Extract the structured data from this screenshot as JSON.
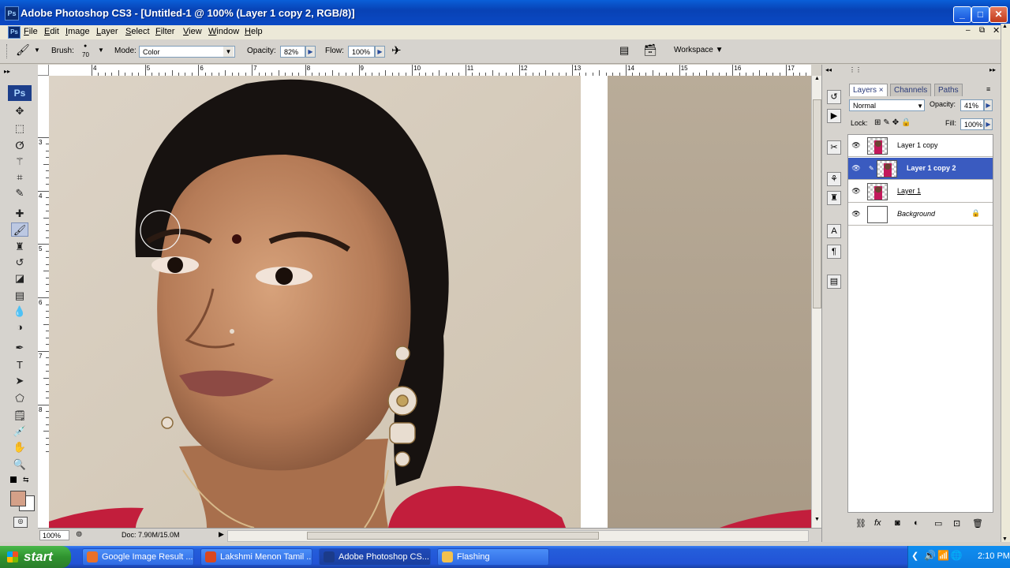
{
  "window": {
    "app_badge": "Ps",
    "title": "Adobe Photoshop CS3 - [Untitled-1 @ 100% (Layer 1 copy 2, RGB/8)]",
    "controls": [
      "_",
      "□",
      "✕"
    ]
  },
  "menu": [
    "File",
    "Edit",
    "Image",
    "Layer",
    "Select",
    "Filter",
    "View",
    "Window",
    "Help"
  ],
  "options": {
    "brush_label": "Brush:",
    "brush_size": "70",
    "mode_label": "Mode:",
    "mode_value": "Color",
    "opacity_label": "Opacity:",
    "opacity_value": "82%",
    "flow_label": "Flow:",
    "flow_value": "100%",
    "workspace_label": "Workspace"
  },
  "rulers": {
    "top_ticks": [
      "4",
      "5",
      "6",
      "7",
      "8",
      "9",
      "10",
      "11",
      "12",
      "13",
      "14",
      "15",
      "16",
      "17"
    ],
    "left_ticks": [
      "3",
      "4",
      "5",
      "6",
      "7",
      "8"
    ]
  },
  "toolbox": {
    "logo": "Ps",
    "tools": [
      {
        "icon": "move-icon",
        "glyph": "✥"
      },
      {
        "icon": "marquee-icon",
        "glyph": "⬚"
      },
      {
        "icon": "lasso-icon",
        "glyph": "ⵚ"
      },
      {
        "icon": "magic-wand-icon",
        "glyph": "⚚"
      },
      {
        "icon": "crop-icon",
        "glyph": "⌗"
      },
      {
        "icon": "slice-icon",
        "glyph": "✎"
      },
      {
        "icon": "healing-brush-icon",
        "glyph": "✚"
      },
      {
        "icon": "brush-icon",
        "glyph": "🖌"
      },
      {
        "icon": "clone-stamp-icon",
        "glyph": "♜"
      },
      {
        "icon": "history-brush-icon",
        "glyph": "↺"
      },
      {
        "icon": "eraser-icon",
        "glyph": "◪"
      },
      {
        "icon": "gradient-icon",
        "glyph": "▤"
      },
      {
        "icon": "blur-icon",
        "glyph": "💧"
      },
      {
        "icon": "dodge-icon",
        "glyph": "◑"
      },
      {
        "icon": "pen-icon",
        "glyph": "✒"
      },
      {
        "icon": "type-icon",
        "glyph": "T"
      },
      {
        "icon": "path-selection-icon",
        "glyph": "➤"
      },
      {
        "icon": "shape-icon",
        "glyph": "⬠"
      },
      {
        "icon": "notes-icon",
        "glyph": "🗒"
      },
      {
        "icon": "eyedropper-icon",
        "glyph": "💉"
      },
      {
        "icon": "hand-icon",
        "glyph": "✋"
      },
      {
        "icon": "zoom-icon",
        "glyph": "🔍"
      }
    ],
    "foreground_color": "#d4a088",
    "background_color": "#ffffff"
  },
  "status": {
    "zoom": "100%",
    "doc": "Doc: 7.90M/15.0M"
  },
  "layers_panel": {
    "tabs": [
      "Layers",
      "Channels",
      "Paths"
    ],
    "blend_mode": "Normal",
    "opacity_label": "Opacity:",
    "opacity_value": "41%",
    "lock_label": "Lock:",
    "fill_label": "Fill:",
    "fill_value": "100%",
    "layers": [
      {
        "name": "Layer 1 copy",
        "selected": false
      },
      {
        "name": "Layer 1 copy 2",
        "selected": true
      },
      {
        "name": "Layer 1",
        "selected": false
      },
      {
        "name": "Background",
        "selected": false,
        "locked": true
      }
    ]
  },
  "taskbar": {
    "start_label": "start",
    "items": [
      {
        "label": "Google Image Result ...",
        "icon_color": "#e8702a",
        "active": false
      },
      {
        "label": "Lakshmi Menon Tamil ...",
        "icon_color": "#d9471f",
        "active": false
      },
      {
        "label": "Adobe Photoshop CS...",
        "icon_color": "#1b3b8a",
        "active": true
      },
      {
        "label": "Flashing",
        "icon_color": "#f2c14e",
        "active": false
      }
    ],
    "clock": "2:10 PM"
  }
}
